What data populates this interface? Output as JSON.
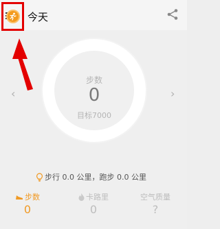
{
  "header": {
    "title": "今天",
    "share_icon": "share-icon",
    "app_icon": "running-man-icon"
  },
  "ring": {
    "label": "步数",
    "value": "0",
    "goal": "目标7000"
  },
  "nav": {
    "prev_glyph": "‹",
    "next_glyph": "›"
  },
  "summary": {
    "text": "步行 0.0 公里，跑步 0.0 公里"
  },
  "stats": [
    {
      "label": "步数",
      "value": "0",
      "icon": "shoe-icon",
      "active": true
    },
    {
      "label": "卡路里",
      "value": "0",
      "icon": "flame-icon",
      "active": false
    },
    {
      "label": "空气质量",
      "value": "?",
      "icon": "",
      "active": false
    }
  ],
  "colors": {
    "accent": "#f09a25",
    "annotation": "#e30000",
    "muted": "#bdbdbd"
  }
}
